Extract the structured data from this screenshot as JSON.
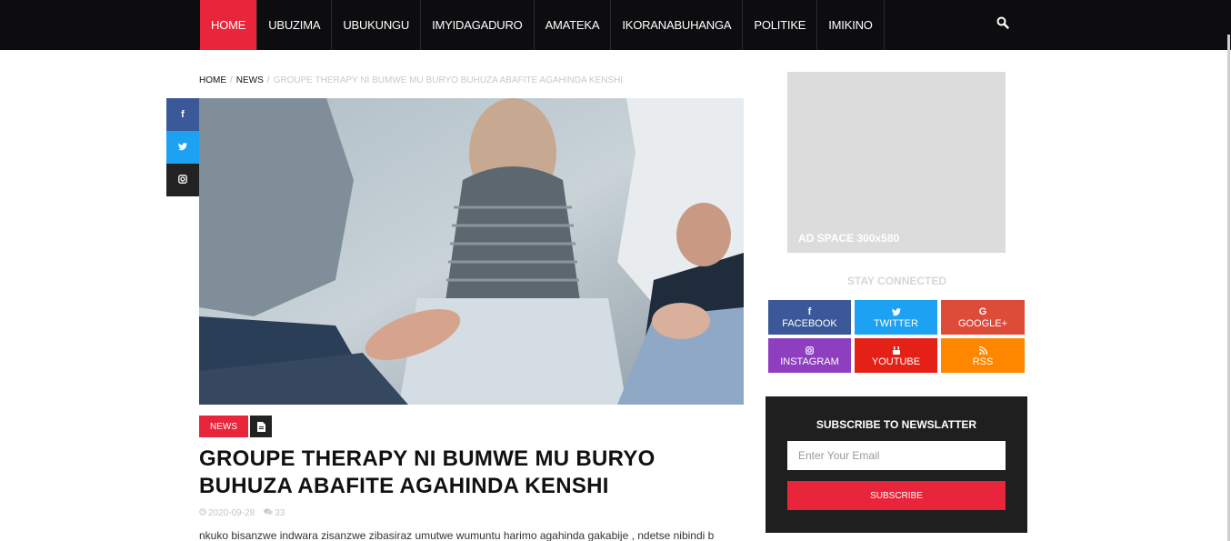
{
  "nav": {
    "items": [
      {
        "label": "HOME",
        "active": true
      },
      {
        "label": "UBUZIMA"
      },
      {
        "label": "UBUKUNGU"
      },
      {
        "label": "IMYIDAGADURO"
      },
      {
        "label": "AMATEKA"
      },
      {
        "label": "IKORANABUHANGA"
      },
      {
        "label": "POLITIKE"
      },
      {
        "label": "IMIKINO"
      }
    ],
    "search_icon": "search-icon"
  },
  "breadcrumb": {
    "home": "HOME",
    "section": "NEWS",
    "current": "GROUPE THERAPY NI BUMWE MU BURYO BUHUZA ABAFITE AGAHINDA KENSHI",
    "separator": "/"
  },
  "share": {
    "icons": [
      "facebook-icon",
      "twitter-icon",
      "instagram-icon"
    ]
  },
  "article": {
    "category": "NEWS",
    "format_icon": "document-icon",
    "title": "GROUPE THERAPY NI BUMWE MU BURYO BUHUZA ABAFITE AGAHINDA KENSHI",
    "date": "2020-09-28",
    "comments": "33",
    "excerpt": "nkuko bisanzwe indwara zisanzwe zibasiraz umutwe wumuntu harimo agahinda gakabije , ndetse nibindi b"
  },
  "sidebar": {
    "ad_label": "AD SPACE 300x580",
    "stay_connected": "STAY CONNECTED",
    "social": [
      {
        "label": "FACEBOOK",
        "color": "#3b5998",
        "icon": "facebook-icon"
      },
      {
        "label": "TWITTER",
        "color": "#1da1f2",
        "icon": "twitter-icon"
      },
      {
        "label": "GOOGLE+",
        "color": "#dd4b39",
        "icon": "google-plus-icon"
      },
      {
        "label": "INSTAGRAM",
        "color": "#8e3fbf",
        "icon": "instagram-icon"
      },
      {
        "label": "YOUTUBE",
        "color": "#e52117",
        "icon": "youtube-icon"
      },
      {
        "label": "RSS",
        "color": "#ff8700",
        "icon": "rss-icon"
      }
    ],
    "newsletter": {
      "title": "SUBSCRIBE TO NEWSLATTER",
      "placeholder": "Enter Your Email",
      "button": "SUBSCRIBE"
    }
  },
  "colors": {
    "accent": "#e8253b",
    "nav_bg": "#0d0d0f",
    "newsletter_bg": "#1f1f1f"
  }
}
